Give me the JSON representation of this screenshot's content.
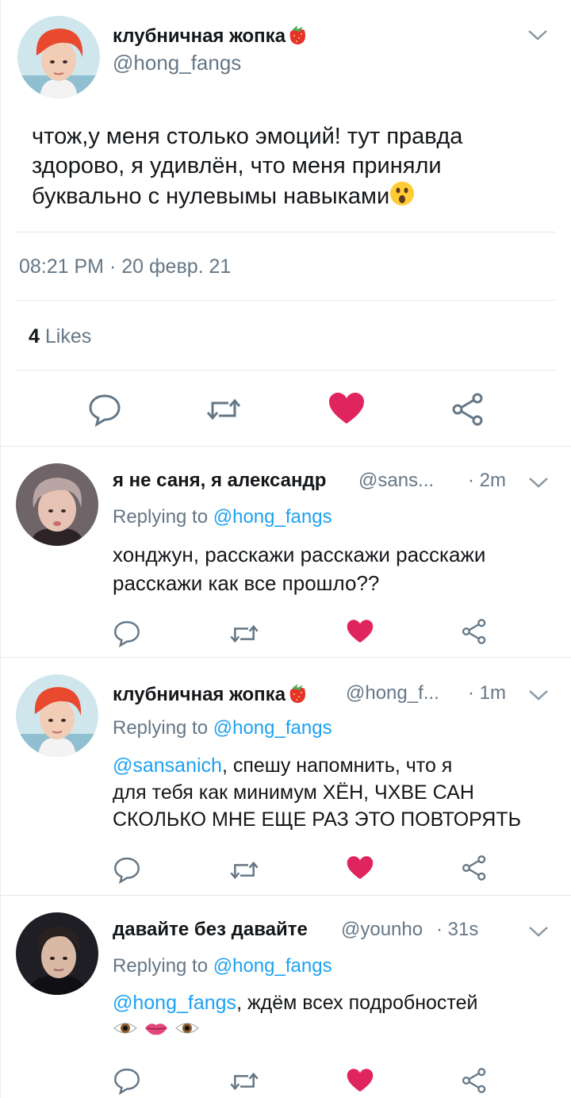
{
  "main_tweet": {
    "display_name": "клубничная жопка",
    "handle": "@hong_fangs",
    "text": "чтож,у меня столько эмоций! тут правда здорово, я удивлён, что меня приняли буквально с нулевымы навыками",
    "text_lines": [
      "чтож,у меня столько эмоций! тут правда",
      "здорово, я удивлён, что меня приняли",
      "буквально с нулевымы навыками"
    ],
    "emoji": "astonished-face",
    "timestamp": "08:21 PM · 20 февр. 21",
    "likes_count": "4",
    "likes_label": "Likes"
  },
  "replies": [
    {
      "display_name": "я не саня, я александр",
      "handle": "@sans...",
      "time": "· 2m",
      "replying_label": "Replying to",
      "replying_to": "@hong_fangs",
      "text_lines": [
        "хонджун, расскажи расскажи расскажи",
        "расскажи как все прошло??"
      ]
    },
    {
      "display_name": "клубничная жопка",
      "handle": "@hong_f...",
      "time": "· 1m",
      "replying_label": "Replying to",
      "replying_to": "@hong_fangs",
      "mention": "@sansanich",
      "text_first_rest": ", спешу напомнить, что я",
      "text_lines": [
        "для тебя как минимум ХЁН, ЧХВЕ САН",
        "СКОЛЬКО МНЕ ЕЩЕ РАЗ ЭТО ПОВТОРЯТЬ"
      ]
    },
    {
      "display_name": "давайте без давайте",
      "handle": "@younho",
      "time": "· 31s",
      "replying_label": "Replying to",
      "replying_to": "@hong_fangs",
      "mention": "@hong_fangs",
      "text_first_rest": ", ждём всех подробностей",
      "emojis": [
        "eye",
        "lips",
        "eye"
      ]
    }
  ],
  "colors": {
    "accent": "#1da1f2",
    "secondary_text": "#657786",
    "like_red": "#e0245e",
    "icon_gray": "#657786"
  }
}
